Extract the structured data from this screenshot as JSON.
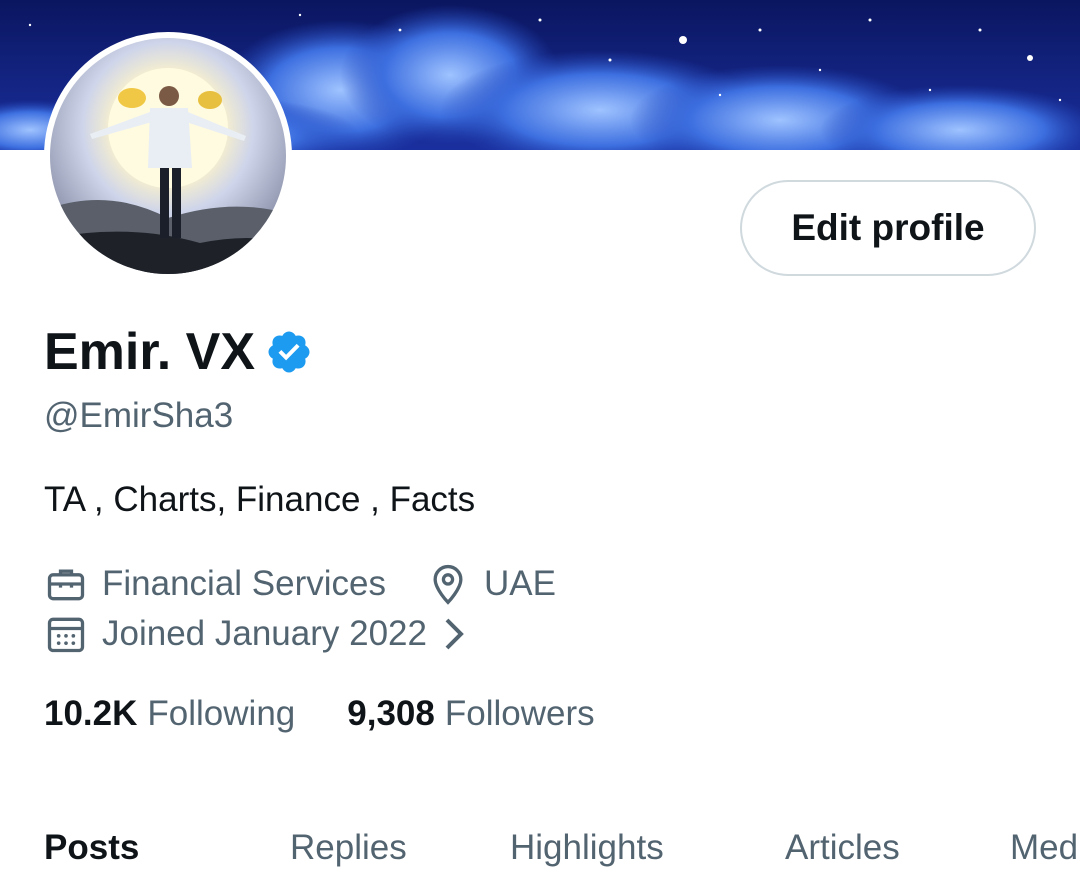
{
  "profile": {
    "display_name": "Emir. VX",
    "handle": "@EmirSha3",
    "bio": "TA , Charts, Finance , Facts",
    "category": "Financial Services",
    "location": "UAE",
    "joined": "Joined January 2022",
    "verified": true
  },
  "actions": {
    "edit_profile_label": "Edit profile"
  },
  "stats": {
    "following_count": "10.2K",
    "following_label": "Following",
    "followers_count": "9,308",
    "followers_label": "Followers"
  },
  "tabs": [
    {
      "label": "Posts"
    },
    {
      "label": "Replies"
    },
    {
      "label": "Highlights"
    },
    {
      "label": "Articles"
    },
    {
      "label": "Media"
    }
  ],
  "colors": {
    "text_primary": "#0f1419",
    "text_secondary": "#536471",
    "verified_blue": "#1d9bf0",
    "border": "#cfd9de"
  },
  "icons": {
    "verified": "verified-badge-icon",
    "category": "briefcase-icon",
    "location": "location-pin-icon",
    "joined": "calendar-icon",
    "joined_more": "chevron-right-icon"
  }
}
